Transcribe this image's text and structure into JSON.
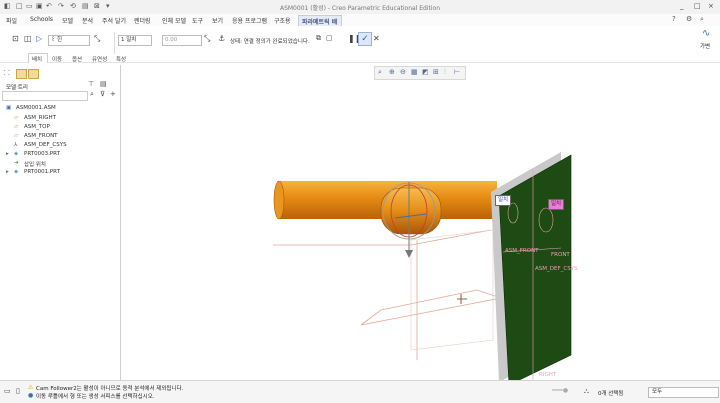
{
  "window": {
    "title": "ASM0001 (활성) - Creo Parametric Educational Edition",
    "controls": [
      "_",
      "□",
      "×"
    ]
  },
  "quick_access": [
    "new-icon",
    "open-icon",
    "save-icon",
    "undo-icon",
    "redo-icon",
    "regenerate-icon",
    "windows-icon",
    "close-icon",
    "customize-icon"
  ],
  "menus": [
    "파일",
    "Schools",
    "모델",
    "분석",
    "주석 달기",
    "렌더링",
    "인체 모델",
    "도구",
    "보기",
    "응용 프로그램",
    "구조용",
    "파라메트릭 배치"
  ],
  "active_menu_index": 11,
  "ribbon": {
    "constraint_type": "1 일치",
    "offset_value": "0.00",
    "status_text": "상태: 연결 정의가 완료되었습니다.",
    "flexible_label": "가변",
    "offset_type": "일치"
  },
  "subtabs": [
    "배치",
    "이동",
    "옵션",
    "유연성",
    "특성"
  ],
  "model_tree": {
    "label": "모델 트리",
    "items": [
      {
        "label": "ASM0001.ASM",
        "icon": "assembly-icon"
      },
      {
        "label": "ASM_RIGHT",
        "icon": "datum-plane-icon"
      },
      {
        "label": "ASM_TOP",
        "icon": "datum-plane-icon"
      },
      {
        "label": "ASM_FRONT",
        "icon": "datum-plane-icon"
      },
      {
        "label": "ASM_DEF_CSYS",
        "icon": "csys-icon"
      },
      {
        "label": "PRT0003.PRT",
        "icon": "part-icon"
      },
      {
        "label": "삽입 위치",
        "icon": "insert-here-icon"
      },
      {
        "label": "PRT0001.PRT",
        "icon": "part-icon"
      }
    ]
  },
  "viewport": {
    "tags": {
      "left": "일치",
      "right": "일치"
    },
    "datum_labels": {
      "asm_front": "ASM_FRONT",
      "front": "FRONT",
      "csys": "ASM_DEF_CSYS",
      "right": "RIGHT"
    }
  },
  "status": {
    "line1": "Cam Follower2는 활성이 아니므로 동적 분석에서 제외됩니다.",
    "line2": "이동 루틀에서 형 또는 생성 서피스를 선택하십시오.",
    "selection_count": "0개 선택됨",
    "filter": "모두"
  },
  "colors": {
    "pipe": "#e58a12",
    "plate_face": "#1e4a14",
    "plate_edge": "#c9c9c9",
    "tag_bg_left": "#ffffff",
    "tag_bg_right": "#f07ad8",
    "accent": "#3d6fb6"
  }
}
